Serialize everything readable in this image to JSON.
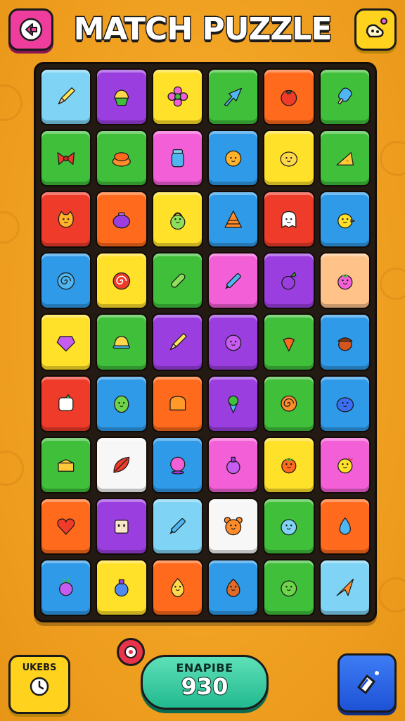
{
  "header": {
    "title": "MATCH PUZZLE",
    "back_icon": "arrow-left-icon",
    "corner_icon": "sticker-icon"
  },
  "board": {
    "rows": 9,
    "cols": 6,
    "tiles": [
      [
        {
          "color": "lightblue",
          "icon": "pencil"
        },
        {
          "color": "purple",
          "icon": "cupcake"
        },
        {
          "color": "yellow",
          "icon": "flower"
        },
        {
          "color": "green",
          "icon": "arrow"
        },
        {
          "color": "orange",
          "icon": "tomato"
        },
        {
          "color": "green",
          "icon": "popsicle"
        }
      ],
      [
        {
          "color": "green",
          "icon": "bow"
        },
        {
          "color": "green",
          "icon": "pudding"
        },
        {
          "color": "pink",
          "icon": "jar"
        },
        {
          "color": "blue",
          "icon": "sun-face"
        },
        {
          "color": "yellow",
          "icon": "lemon-face"
        },
        {
          "color": "green",
          "icon": "cheese"
        }
      ],
      [
        {
          "color": "red",
          "icon": "cat-face"
        },
        {
          "color": "orange",
          "icon": "pot"
        },
        {
          "color": "yellow",
          "icon": "kettlebell"
        },
        {
          "color": "blue",
          "icon": "cone-stack"
        },
        {
          "color": "red",
          "icon": "ghost-face"
        },
        {
          "color": "blue",
          "icon": "chick"
        }
      ],
      [
        {
          "color": "blue",
          "icon": "swirl"
        },
        {
          "color": "yellow",
          "icon": "spiral-candy"
        },
        {
          "color": "green",
          "icon": "cucumber"
        },
        {
          "color": "pink",
          "icon": "pen"
        },
        {
          "color": "purple",
          "icon": "turnip"
        },
        {
          "color": "peach",
          "icon": "berry-face"
        }
      ],
      [
        {
          "color": "yellow",
          "icon": "gem"
        },
        {
          "color": "green",
          "icon": "bell"
        },
        {
          "color": "purple",
          "icon": "pencil"
        },
        {
          "color": "purple",
          "icon": "plum-face"
        },
        {
          "color": "green",
          "icon": "carrot"
        },
        {
          "color": "blue",
          "icon": "acorn"
        }
      ],
      [
        {
          "color": "red",
          "icon": "marshmallow"
        },
        {
          "color": "blue",
          "icon": "lime-face"
        },
        {
          "color": "orange",
          "icon": "bread"
        },
        {
          "color": "purple",
          "icon": "ice-cream"
        },
        {
          "color": "green",
          "icon": "snail"
        },
        {
          "color": "blue",
          "icon": "blob-face"
        }
      ],
      [
        {
          "color": "green",
          "icon": "box"
        },
        {
          "color": "white",
          "icon": "leaf"
        },
        {
          "color": "blue",
          "icon": "orb"
        },
        {
          "color": "pink",
          "icon": "potion"
        },
        {
          "color": "yellow",
          "icon": "tomato-face"
        },
        {
          "color": "pink",
          "icon": "star-face"
        }
      ],
      [
        {
          "color": "orange",
          "icon": "heart"
        },
        {
          "color": "purple",
          "icon": "robot"
        },
        {
          "color": "lightblue",
          "icon": "pen"
        },
        {
          "color": "white",
          "icon": "bear-face"
        },
        {
          "color": "green",
          "icon": "water-face"
        },
        {
          "color": "orange",
          "icon": "drop"
        }
      ],
      [
        {
          "color": "blue",
          "icon": "radish"
        },
        {
          "color": "yellow",
          "icon": "bottle"
        },
        {
          "color": "orange",
          "icon": "flame-face"
        },
        {
          "color": "blue",
          "icon": "nut-face"
        },
        {
          "color": "green",
          "icon": "pea-face"
        },
        {
          "color": "lightblue",
          "icon": "plane"
        }
      ]
    ]
  },
  "footer": {
    "moves_label": "UKEBS",
    "moves_icon": "clock-icon",
    "badge_icon": "target-icon",
    "score_label": "ENAPIBE",
    "score_value": "930",
    "action_icon": "shuffle-icon"
  },
  "colors": {
    "blue": "#2f9ae8",
    "lightblue": "#7fd3f5",
    "purple": "#9a3ee0",
    "yellow": "#ffe12a",
    "green": "#3fbf3a",
    "orange": "#ff6a1c",
    "red": "#ee3b2a",
    "pink": "#f25fd6",
    "peach": "#ffc38a",
    "white": "#f7f7f7",
    "background": "#f0a021",
    "score_pill": "#22b98f",
    "back_button": "#ee3d9c"
  }
}
